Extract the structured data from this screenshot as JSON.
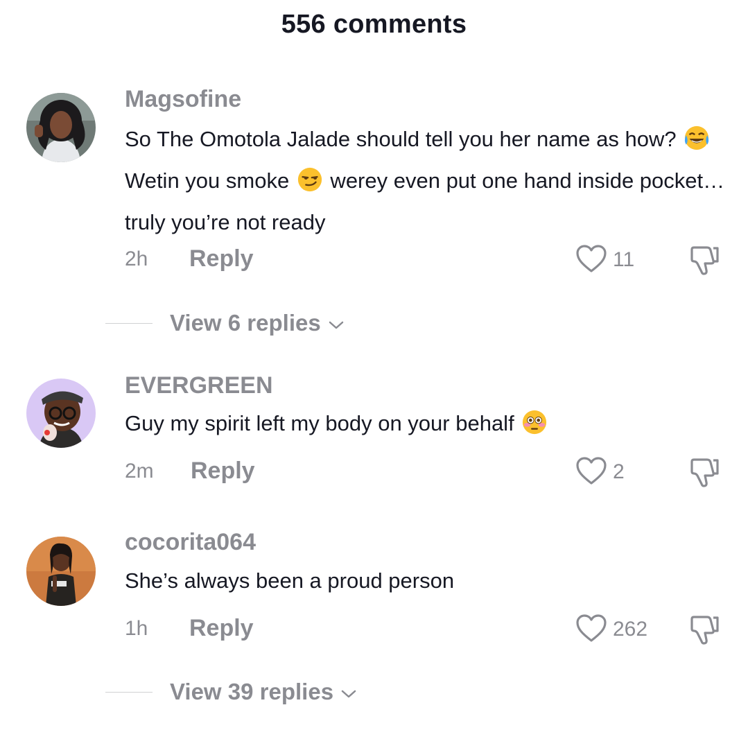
{
  "header": {
    "title": "556 comments"
  },
  "comments": [
    {
      "username": "Magsofine",
      "text_parts": [
        "So The Omotola Jalade should tell you her name as how? ",
        " Wetin you smoke ",
        " werey even put one hand inside pocket… truly you’re not ready"
      ],
      "emojis": [
        "face-with-tears-of-joy",
        "smirking-face"
      ],
      "time": "2h",
      "reply_label": "Reply",
      "likes": "11",
      "view_replies": "View 6 replies"
    },
    {
      "username": "EVERGREEN",
      "text_parts": [
        "Guy my spirit left my body on your behalf "
      ],
      "emojis": [
        "flushed-face"
      ],
      "time": "2m",
      "reply_label": "Reply",
      "likes": "2"
    },
    {
      "username": "cocorita064",
      "text_parts": [
        "She’s always been a proud person"
      ],
      "time": "1h",
      "reply_label": "Reply",
      "likes": "262",
      "view_replies": "View 39 replies"
    }
  ],
  "colors": {
    "text_primary": "#161823",
    "text_secondary": "#8a8b91",
    "divider": "#d0d1d3"
  }
}
